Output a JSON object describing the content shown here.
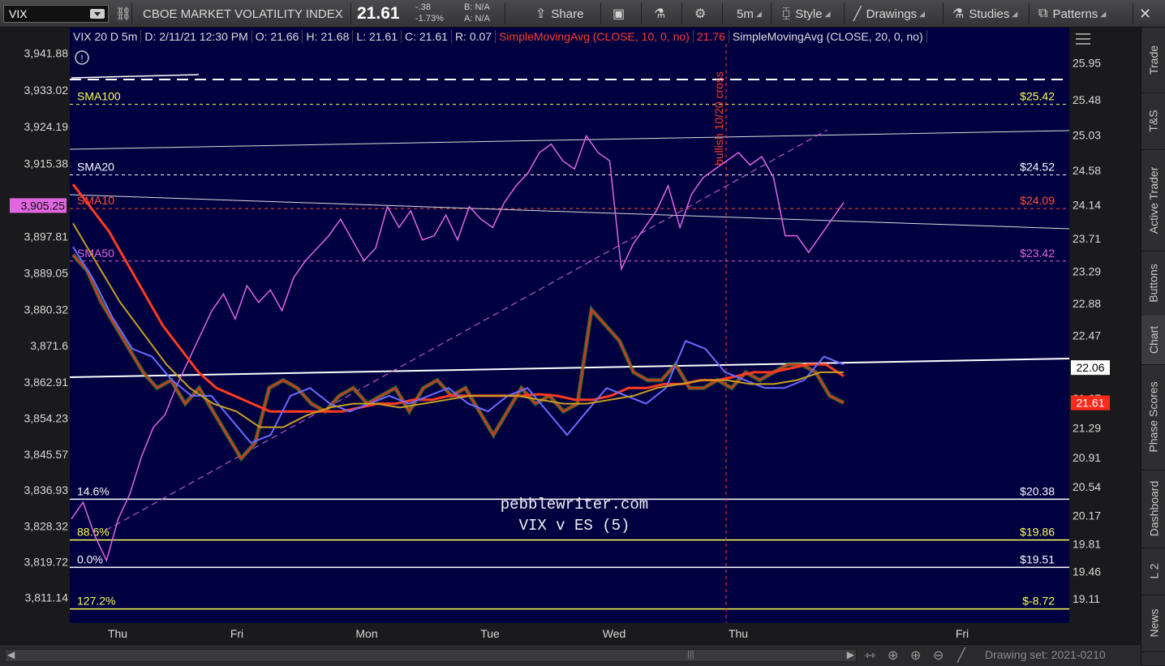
{
  "toolbar": {
    "symbol": "VIX",
    "description": "CBOE MARKET VOLATILITY INDEX",
    "last_price": "21.61",
    "change": "-.38",
    "change_pct": "-1.73%",
    "bid": "B: N/A",
    "ask": "A: N/A",
    "share_label": "Share",
    "timeframe": "5m",
    "style_label": "Style",
    "drawings_label": "Drawings",
    "studies_label": "Studies",
    "patterns_label": "Patterns"
  },
  "header": {
    "chart_id": "VIX 20 D 5m",
    "date": "D: 2/11/21 12:30 PM",
    "open": "O: 21.66",
    "high": "H: 21.68",
    "low": "L: 21.61",
    "close": "C: 21.61",
    "range": "R: 0.07",
    "sma10_label": "SimpleMovingAvg (CLOSE, 10, 0, no)",
    "sma10_value": "21.76",
    "sma20_label": "SimpleMovingAvg (CLOSE, 20, 0, no)"
  },
  "sidebar": {
    "tabs": [
      "Trade",
      "T&S",
      "Active Trader",
      "Buttons",
      "Chart",
      "Phase Scores",
      "Dashboard",
      "L 2",
      "News"
    ],
    "active": "Chart"
  },
  "bottombar": {
    "drawing_set": "Drawing set: 2021-0210"
  },
  "colors": {
    "background": "#000040",
    "vix_candle_up": "#2fbf2f",
    "vix_candle_down": "#d23a1e",
    "es_line": "#e066e0",
    "sma10": "#ff3b1f",
    "sma20": "#6b6bff",
    "sma50": "#c8a020",
    "fib_yellow": "#ffff55",
    "fib_white": "#ffffff"
  },
  "chart_data": {
    "type": "line",
    "title": "",
    "watermark": [
      "pebblewriter.com",
      "VIX v ES (5)"
    ],
    "x_ticks": [
      "Thu",
      "Fri",
      "Mon",
      "Tue",
      "Wed",
      "Thu",
      "Fri"
    ],
    "left_axis": {
      "ticks": [
        "3,941.88",
        "3,933.02",
        "3,924.19",
        "3,915.38",
        "3,905.25",
        "3,897.81",
        "3,889.05",
        "3,880.32",
        "3,871.6",
        "3,862.91",
        "3,854.23",
        "3,845.57",
        "3,836.93",
        "3,828.32",
        "3,819.72",
        "3,811.14"
      ],
      "values": [
        3941.88,
        3933.02,
        3924.19,
        3915.38,
        3905.25,
        3897.81,
        3889.05,
        3880.32,
        3871.6,
        3862.91,
        3854.23,
        3845.57,
        3836.93,
        3828.32,
        3819.72,
        3811.14
      ],
      "range": [
        3805,
        3948
      ],
      "current_label": "3,905.25"
    },
    "right_axis": {
      "ticks": [
        "25.95",
        "25.48",
        "25.03",
        "24.58",
        "24.14",
        "23.71",
        "23.29",
        "22.88",
        "22.47",
        "21.67",
        "21.29",
        "20.91",
        "20.54",
        "20.17",
        "19.81",
        "19.46",
        "19.11"
      ],
      "values": [
        25.95,
        25.48,
        25.03,
        24.58,
        24.14,
        23.71,
        23.29,
        22.88,
        22.47,
        21.67,
        21.29,
        20.91,
        20.54,
        20.17,
        19.81,
        19.46,
        19.11
      ],
      "range": [
        18.8,
        26.4
      ],
      "highlight_labels": [
        {
          "value": 22.06,
          "text": "22.06",
          "style": "white"
        },
        {
          "value": 21.61,
          "text": "21.61",
          "style": "red"
        }
      ]
    },
    "levels": [
      {
        "name": "SMA100",
        "left_label": "SMA100",
        "right_label": "$25.42",
        "value": 25.42,
        "color": "#ffff55",
        "dash": true
      },
      {
        "name": "SMA20",
        "left_label": "SMA20",
        "right_label": "$24.52",
        "value": 24.52,
        "color": "#ffffff",
        "dash": true
      },
      {
        "name": "SMA10",
        "left_label": "SMA10",
        "right_label": "$24.09",
        "value": 24.09,
        "color": "#ff5030",
        "dash": true
      },
      {
        "name": "SMA50",
        "left_label": "SMA50",
        "right_label": "$23.42",
        "value": 23.42,
        "color": "#e066e0",
        "dash": true
      },
      {
        "name": "fib-14.6",
        "left_label": "14.6%",
        "right_label": "$20.38",
        "value": 20.38,
        "color": "#ffffff",
        "dash": false
      },
      {
        "name": "fib-88.6",
        "left_label": "88.6%",
        "right_label": "$19.86",
        "value": 19.86,
        "color": "#ffff55",
        "dash": false
      },
      {
        "name": "fib-0.0",
        "left_label": "0.0%",
        "right_label": "$19.51",
        "value": 19.51,
        "color": "#ffffff",
        "dash": false
      },
      {
        "name": "fib-127.2",
        "left_label": "127.2%",
        "right_label": "$-8.72",
        "value": 18.98,
        "color": "#ffff55",
        "dash": false
      }
    ],
    "annotation": "bullish 10/20 cross",
    "series": [
      {
        "name": "ES",
        "axis": "left",
        "values": [
          3830,
          3834,
          3826,
          3820,
          3830,
          3836,
          3845,
          3852,
          3855,
          3862,
          3868,
          3874,
          3880,
          3884,
          3878,
          3886,
          3882,
          3885,
          3880,
          3888,
          3892,
          3895,
          3898,
          3902,
          3897,
          3892,
          3895,
          3905,
          3900,
          3904,
          3897,
          3898,
          3903,
          3897,
          3905,
          3902,
          3900,
          3906,
          3910,
          3913,
          3918,
          3920,
          3916,
          3914,
          3922,
          3918,
          3916,
          3890,
          3896,
          3900,
          3904,
          3910,
          3900,
          3908,
          3912,
          3914,
          3916,
          3918,
          3915,
          3917,
          3912,
          3898,
          3898,
          3894,
          3898,
          3902,
          3906
        ]
      },
      {
        "name": "VIX",
        "axis": "right",
        "values": [
          23.5,
          23.3,
          22.9,
          22.6,
          22.3,
          22.0,
          21.8,
          21.9,
          21.6,
          21.8,
          21.5,
          21.2,
          20.9,
          21.1,
          21.8,
          21.9,
          21.8,
          21.6,
          21.5,
          21.7,
          21.8,
          21.6,
          21.7,
          21.8,
          21.5,
          21.8,
          21.9,
          21.7,
          21.8,
          21.5,
          21.2,
          21.5,
          21.8,
          21.6,
          21.7,
          21.5,
          21.6,
          22.8,
          22.6,
          22.4,
          22.0,
          21.9,
          21.9,
          22.1,
          21.8,
          21.8,
          21.9,
          21.8,
          22.0,
          21.9,
          22.0,
          22.1,
          22.1,
          22.0,
          21.7,
          21.61
        ]
      },
      {
        "name": "SMA10",
        "axis": "right",
        "values": [
          24.4,
          24.1,
          23.8,
          23.4,
          23.0,
          22.6,
          22.3,
          22.0,
          21.8,
          21.7,
          21.6,
          21.5,
          21.5,
          21.5,
          21.5,
          21.5,
          21.55,
          21.6,
          21.6,
          21.65,
          21.65,
          21.7,
          21.7,
          21.7,
          21.7,
          21.7,
          21.72,
          21.7,
          21.65,
          21.65,
          21.7,
          21.8,
          21.8,
          21.85,
          21.85,
          21.9,
          21.9,
          21.95,
          22.0,
          22.0,
          22.05,
          22.1,
          22.1,
          21.95
        ]
      },
      {
        "name": "SMA20",
        "axis": "right",
        "values": [
          23.6,
          23.2,
          22.7,
          22.3,
          22.2,
          21.9,
          21.7,
          21.7,
          21.4,
          21.1,
          21.2,
          21.7,
          21.8,
          21.6,
          21.5,
          21.6,
          21.7,
          21.6,
          21.7,
          21.8,
          21.6,
          21.5,
          21.7,
          21.8,
          21.5,
          21.2,
          21.5,
          21.8,
          21.7,
          21.6,
          21.8,
          22.4,
          22.3,
          22.0,
          21.9,
          21.8,
          21.8,
          21.9,
          22.2,
          22.1
        ]
      },
      {
        "name": "SMA50",
        "axis": "right",
        "values": [
          23.9,
          23.4,
          22.9,
          22.5,
          22.1,
          21.8,
          21.6,
          21.5,
          21.3,
          21.3,
          21.45,
          21.55,
          21.6,
          21.6,
          21.55,
          21.6,
          21.65,
          21.7,
          21.7,
          21.7,
          21.65,
          21.6,
          21.6,
          21.65,
          21.7,
          21.8,
          21.85,
          21.9,
          21.9,
          21.85,
          21.85,
          21.9,
          22.0,
          22.0
        ]
      }
    ]
  }
}
